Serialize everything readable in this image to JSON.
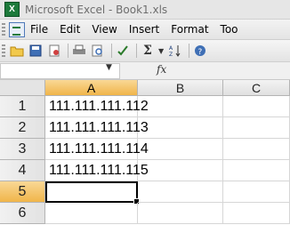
{
  "window": {
    "title": "Microsoft Excel - Book1.xls",
    "app_icon_glyph": "X"
  },
  "menubar": {
    "items": [
      "File",
      "Edit",
      "View",
      "Insert",
      "Format",
      "Too"
    ]
  },
  "toolbar": {
    "sum_label": "Σ"
  },
  "formula_bar": {
    "name_box": "",
    "fx_label": "fx",
    "formula": ""
  },
  "sheet": {
    "columns": [
      "A",
      "B",
      "C"
    ],
    "rows": [
      {
        "num": "1",
        "A": "111.111.111.112"
      },
      {
        "num": "2",
        "A": "111.111.111.113"
      },
      {
        "num": "3",
        "A": "111.111.111.114"
      },
      {
        "num": "4",
        "A": "111.111.111.115"
      },
      {
        "num": "5",
        "A": ""
      },
      {
        "num": "6",
        "A": ""
      }
    ],
    "active_column": "A",
    "active_row": "5"
  },
  "colors": {
    "accent_header": "#f0b54a",
    "excel_green": "#1d7a3b"
  }
}
